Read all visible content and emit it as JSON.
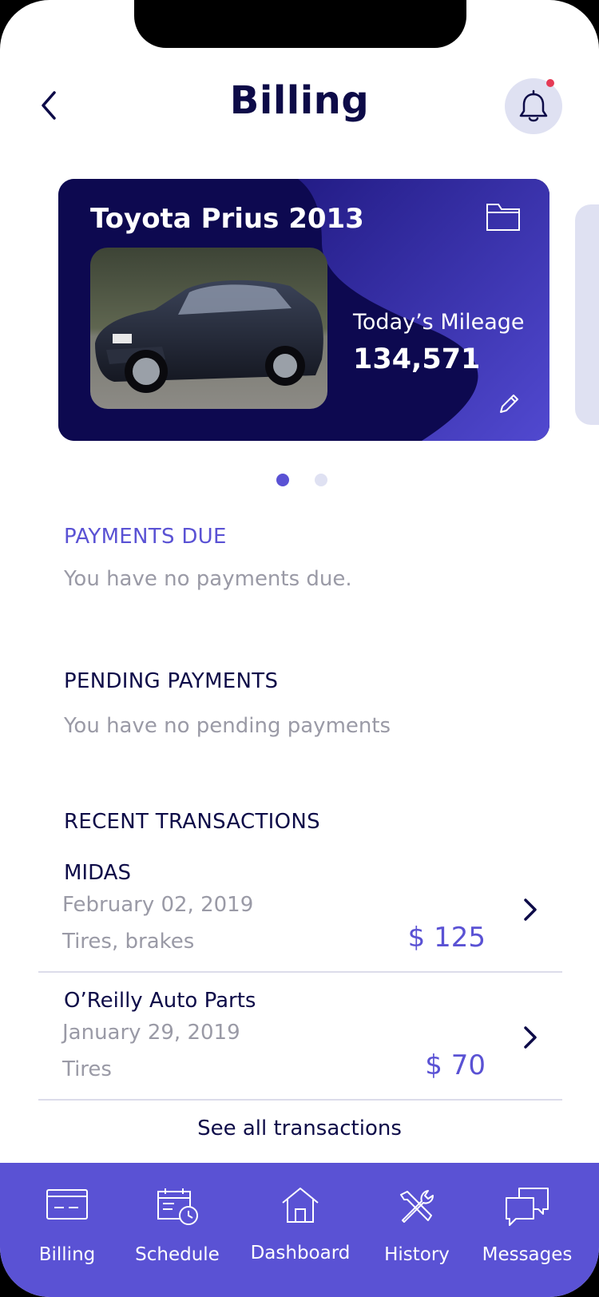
{
  "header": {
    "title": "Billing"
  },
  "vehicle_card": {
    "name": "Toyota Prius 2013",
    "mileage_label": "Today’s Mileage",
    "mileage_value": "134,571"
  },
  "carousel": {
    "count": 2,
    "active_index": 0
  },
  "payments_due": {
    "heading": "PAYMENTS DUE",
    "message": "You have no payments due."
  },
  "pending_payments": {
    "heading": "PENDING PAYMENTS",
    "message": "You have no pending payments"
  },
  "recent_transactions": {
    "heading": "RECENT TRANSACTIONS",
    "items": [
      {
        "merchant": "MIDAS",
        "date": "February 02, 2019",
        "description": "Tires, brakes",
        "amount": "$ 125"
      },
      {
        "merchant": "O’Reilly Auto Parts",
        "date": "January 29, 2019",
        "description": "Tires",
        "amount": "$ 70"
      }
    ],
    "see_all_label": "See all transactions"
  },
  "tabbar": {
    "items": [
      {
        "label": "Billing",
        "icon": "credit-card-icon"
      },
      {
        "label": "Schedule",
        "icon": "calendar-clock-icon"
      },
      {
        "label": "Dashboard",
        "icon": "home-icon"
      },
      {
        "label": "History",
        "icon": "tools-icon"
      },
      {
        "label": "Messages",
        "icon": "chat-bubbles-icon"
      }
    ]
  },
  "colors": {
    "accent": "#5a52d4",
    "navy": "#0d0b48",
    "muted": "#9a9aa6",
    "notification_dot": "#e53a55"
  }
}
